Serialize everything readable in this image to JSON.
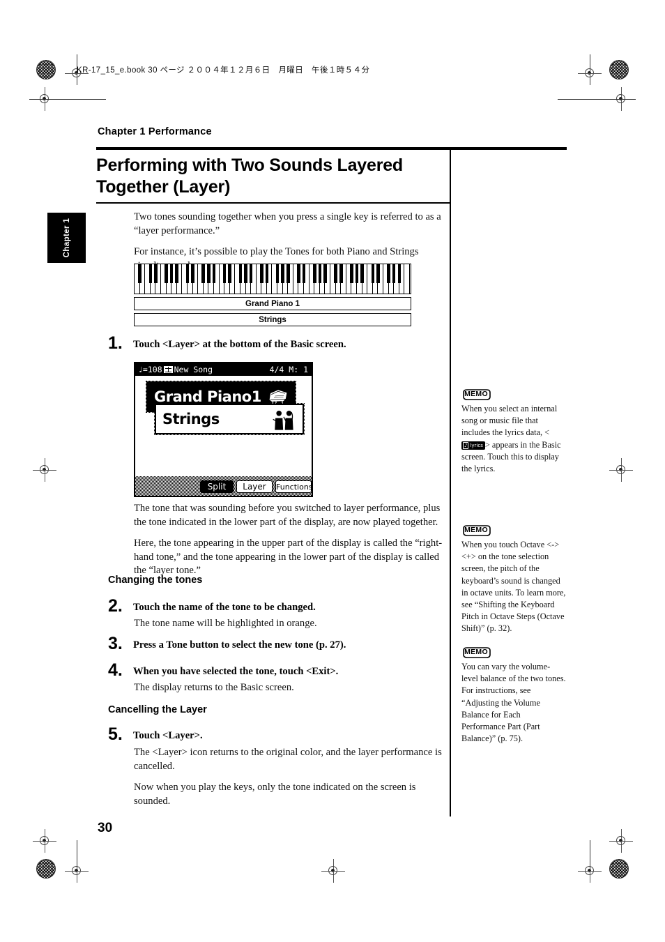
{
  "print_header": "KR-17_15_e.book  30 ページ  ２００４年１２月６日　月曜日　午後１時５４分",
  "chapter_label": "Chapter 1 Performance",
  "chapter_tab": "Chapter 1",
  "page_number": "30",
  "title": "Performing with Two Sounds Layered Together (Layer)",
  "intro": {
    "p1": "Two tones sounding together when you press a single key is referred to as a “layer performance.”",
    "p2": "For instance, it’s possible to play the Tones for both Piano and Strings simultaneously."
  },
  "keyboard_diagram": {
    "upper_tone": "Grand Piano 1",
    "lower_tone": "Strings"
  },
  "steps": [
    {
      "num": "1.",
      "text": "Touch <Layer> at the bottom of the Basic screen."
    },
    {
      "num": "2.",
      "text": "Touch the name of the tone to be changed."
    },
    {
      "num": "3.",
      "text": "Press a Tone button to select the new tone (p. 27)."
    },
    {
      "num": "4.",
      "text": "When you have selected the tone, touch <Exit>."
    },
    {
      "num": "5.",
      "text": "Touch <Layer>."
    }
  ],
  "subheads": {
    "changing": "Changing the tones",
    "cancelling": "Cancelling the Layer"
  },
  "after_step1": {
    "p1": "The tone that was sounding before you switched to layer performance, plus the tone indicated in the lower part of the display, are now played together.",
    "p2": "Here, the tone appearing in the upper part of the display is called the “right-hand tone,” and the tone appearing in the lower part of the display is called the “layer tone.”"
  },
  "after_step2": "The tone name will be highlighted in orange.",
  "after_step4": "The display returns to the Basic screen.",
  "after_step5": {
    "p1": "The <Layer> icon returns to the original color, and the layer performance is cancelled.",
    "p2": "Now when you play the keys, only the tone indicated on the screen is sounded."
  },
  "lcd": {
    "tempo": "♩=108",
    "song_name": "New Song",
    "time_signature": "4/4",
    "measure": "M:   1",
    "upper_tone": "Grand Piano1",
    "lower_tone": "Strings",
    "buttons": {
      "split": "Split",
      "layer": "Layer",
      "functions": "Functions"
    }
  },
  "memos": [
    {
      "label": "MEMO",
      "text_before": "When you select an internal song or music file that includes the lyrics data, <",
      "button_label": "lyrics",
      "text_after": "> appears in the Basic screen. Touch this to display the lyrics."
    },
    {
      "label": "MEMO",
      "text": "When you touch Octave <-><+> on the tone selection screen, the pitch of the keyboard’s sound is changed in octave units. To learn more, see “Shifting the Keyboard Pitch in Octave Steps (Octave Shift)” (p. 32)."
    },
    {
      "label": "MEMO",
      "text": "You can vary the volume-level balance of the two tones. For instructions, see “Adjusting the Volume Balance for Each Performance Part (Part Balance)” (p. 75)."
    }
  ]
}
